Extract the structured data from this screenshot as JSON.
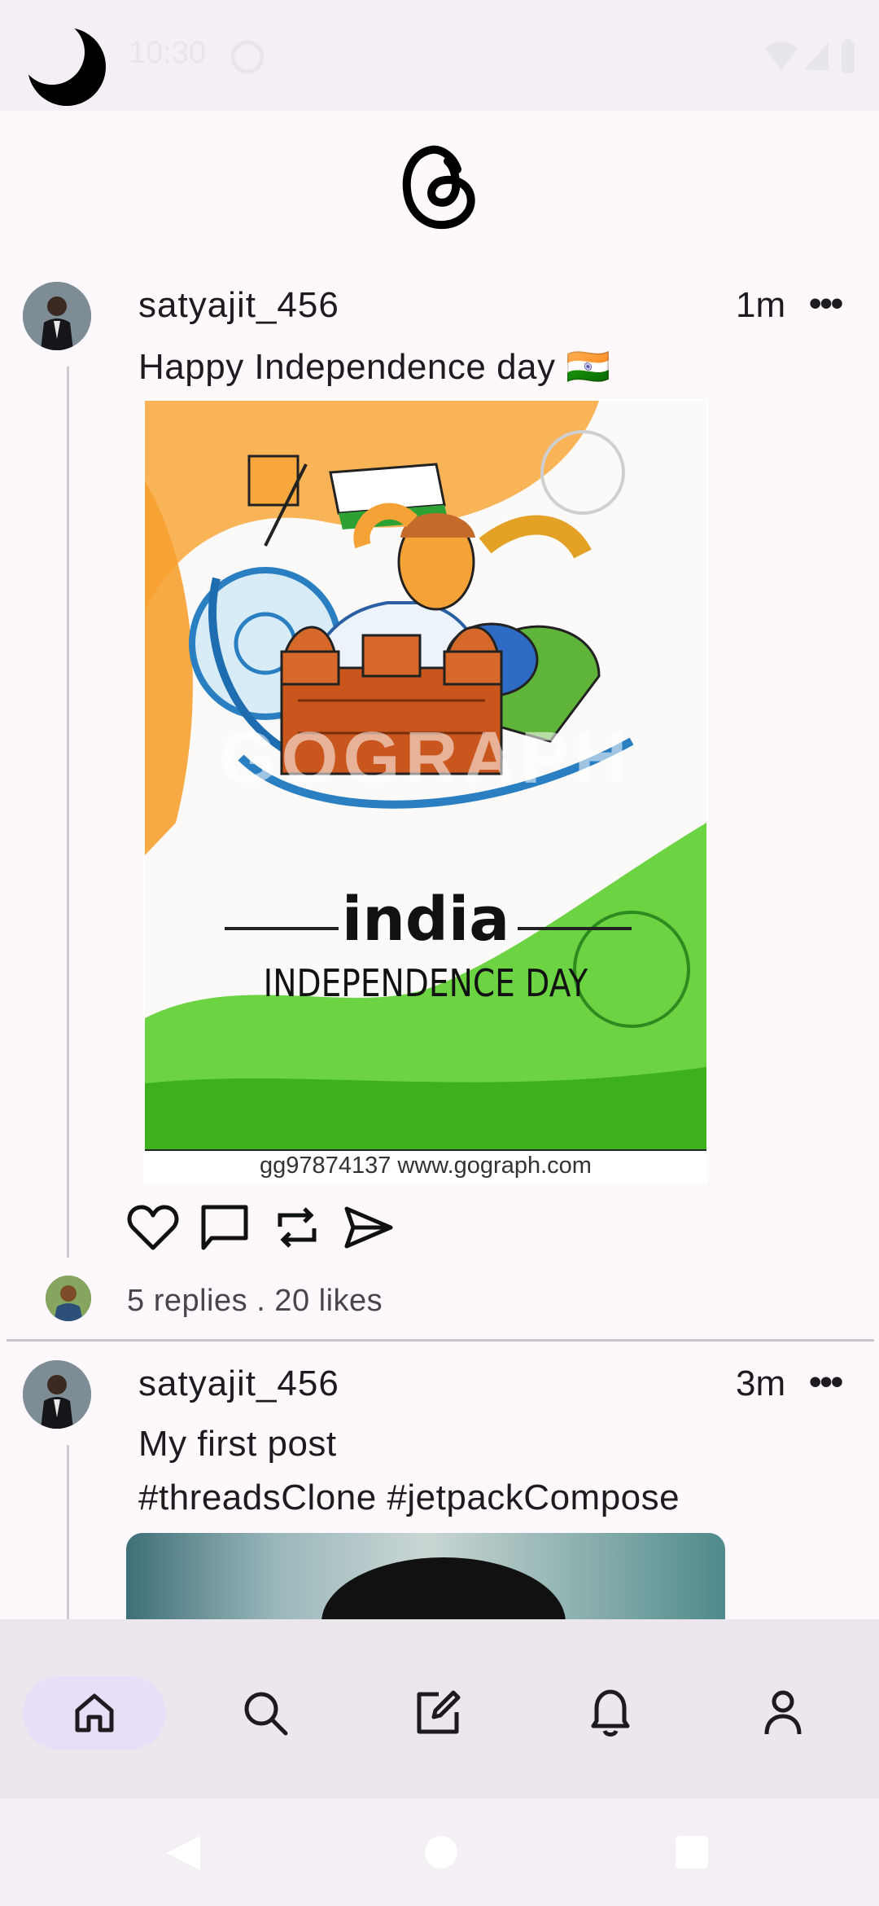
{
  "status_bar": {
    "time": "10:30"
  },
  "posts": [
    {
      "username": "satyajit_456",
      "time": "1m",
      "text": "Happy Independence day 🇮🇳",
      "image": {
        "title_line1": "india",
        "title_line2": "INDEPENDENCE DAY",
        "watermark": "GOGRAPH",
        "caption": "gg97874137  www.gograph.com"
      },
      "stats": "5 replies . 20 likes"
    },
    {
      "username": "satyajit_456",
      "time": "3m",
      "text_line1": "My first post",
      "text_line2": "#threadsClone #jetpackCompose"
    }
  ],
  "bottom_nav": {
    "items": [
      "home-icon",
      "search-icon",
      "compose-icon",
      "notifications-icon",
      "profile-icon"
    ],
    "active": "home-icon"
  },
  "colors": {
    "accent": "#e8def8",
    "nav_bg": "#ece6ed",
    "background": "#fdf8fb"
  }
}
